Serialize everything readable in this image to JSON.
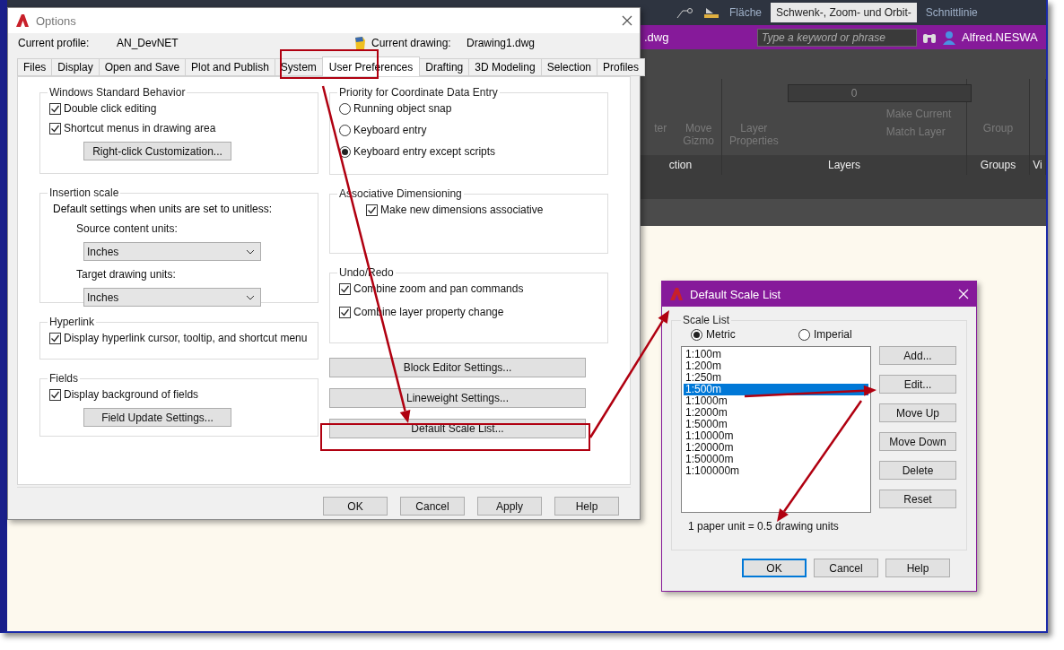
{
  "app": {
    "tooltip": "Schwenk-, Zoom- und Orbit-",
    "toolbar_labels": [
      "Fläche",
      "Schnittlinie"
    ],
    "file_title": ".dwg",
    "search": {
      "placeholder": "Type a keyword or phrase"
    },
    "user": "Alfred.NESWA",
    "ribbon": [
      {
        "kind": "tools",
        "title": "ction",
        "tools": [
          "ter",
          "Move Gizmo"
        ]
      },
      {
        "kind": "layers",
        "title": "Layers",
        "tools": [
          "Layer Properties"
        ],
        "layer": "0",
        "actions": [
          "Make Current",
          "Match Layer"
        ]
      },
      {
        "kind": "tools",
        "title": "Groups",
        "tools": [
          "Group"
        ]
      },
      {
        "kind": "stub",
        "title": "Vi"
      }
    ]
  },
  "options": {
    "title": "Options",
    "profile_label": "Current profile:",
    "profile": "AN_DevNET",
    "drawing_label": "Current drawing:",
    "drawing": "Drawing1.dwg",
    "tabs": [
      {
        "label": "Files",
        "selected": false
      },
      {
        "label": "Display",
        "selected": false
      },
      {
        "label": "Open and Save",
        "selected": false
      },
      {
        "label": "Plot and Publish",
        "selected": false
      },
      {
        "label": "System",
        "selected": false
      },
      {
        "label": "User Preferences",
        "selected": true
      },
      {
        "label": "Drafting",
        "selected": false
      },
      {
        "label": "3D Modeling",
        "selected": false
      },
      {
        "label": "Selection",
        "selected": false
      },
      {
        "label": "Profiles",
        "selected": false
      }
    ],
    "left_sections": [
      {
        "title": "Windows Standard Behavior",
        "items": [
          {
            "kind": "checkbox",
            "label": "Double click editing",
            "checked": true
          },
          {
            "kind": "checkbox",
            "label": "Shortcut menus in drawing area",
            "checked": true
          },
          {
            "kind": "button",
            "label": "Right-click Customization..."
          }
        ]
      },
      {
        "title": "Insertion scale",
        "items": [
          {
            "kind": "note",
            "label": "Default settings when units are set to unitless:"
          },
          {
            "kind": "select",
            "label": "Source content units:",
            "value": "Inches"
          },
          {
            "kind": "select",
            "label": "Target drawing units:",
            "value": "Inches"
          }
        ]
      },
      {
        "title": "Hyperlink",
        "items": [
          {
            "kind": "checkbox",
            "label": "Display hyperlink cursor, tooltip, and shortcut menu",
            "checked": true
          }
        ]
      },
      {
        "title": "Fields",
        "items": [
          {
            "kind": "checkbox",
            "label": "Display background of fields",
            "checked": true
          },
          {
            "kind": "button",
            "label": "Field Update Settings..."
          }
        ]
      }
    ],
    "right_sections": [
      {
        "title": "Priority for Coordinate Data Entry",
        "items": [
          {
            "kind": "radio",
            "label": "Running object snap",
            "selected": false
          },
          {
            "kind": "radio",
            "label": "Keyboard entry",
            "selected": false
          },
          {
            "kind": "radio",
            "label": "Keyboard entry except scripts",
            "selected": true
          }
        ]
      },
      {
        "title": "Associative Dimensioning",
        "items": [
          {
            "kind": "checkbox",
            "label": "Make new dimensions associative",
            "checked": true
          }
        ]
      },
      {
        "title": "Undo/Redo",
        "items": [
          {
            "kind": "checkbox",
            "label": "Combine zoom and pan commands",
            "checked": true
          },
          {
            "kind": "checkbox",
            "label": "Combine layer property change",
            "checked": true
          }
        ]
      }
    ],
    "right_buttons": [
      "Block Editor Settings...",
      "Lineweight Settings...",
      "Default Scale List..."
    ],
    "footer_buttons": [
      "OK",
      "Cancel",
      "Apply",
      "Help"
    ]
  },
  "scale_dialog": {
    "title": "Default Scale List",
    "group": "Scale List",
    "units": [
      {
        "label": "Metric",
        "selected": true
      },
      {
        "label": "Imperial",
        "selected": false
      }
    ],
    "scales": [
      {
        "label": "1:100m",
        "selected": false
      },
      {
        "label": "1:200m",
        "selected": false
      },
      {
        "label": "1:250m",
        "selected": false
      },
      {
        "label": "1:500m",
        "selected": true
      },
      {
        "label": "1:1000m",
        "selected": false
      },
      {
        "label": "1:2000m",
        "selected": false
      },
      {
        "label": "1:5000m",
        "selected": false
      },
      {
        "label": "1:10000m",
        "selected": false
      },
      {
        "label": "1:20000m",
        "selected": false
      },
      {
        "label": "1:50000m",
        "selected": false
      },
      {
        "label": "1:100000m",
        "selected": false
      }
    ],
    "side_buttons": [
      "Add...",
      "Edit...",
      "Move Up",
      "Move Down",
      "Delete",
      "Reset"
    ],
    "info": "1 paper unit = 0.5 drawing units",
    "footer_buttons": [
      {
        "label": "OK",
        "default": true
      },
      {
        "label": "Cancel",
        "default": false
      },
      {
        "label": "Help",
        "default": false
      }
    ]
  }
}
